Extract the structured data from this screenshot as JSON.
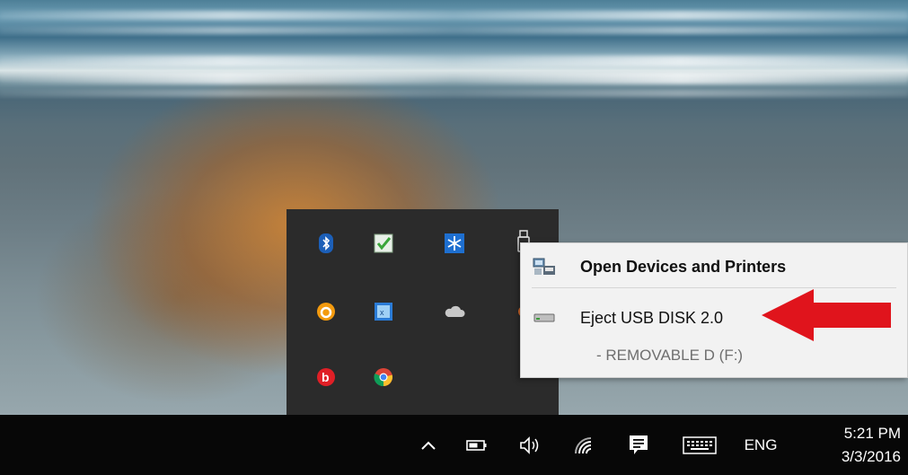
{
  "taskbar": {
    "language": "ENG",
    "time": "5:21 PM",
    "date": "3/3/2016",
    "icons": [
      "chevron-up-icon",
      "battery-icon",
      "speaker-icon",
      "wifi-icon",
      "action-center-icon",
      "keyboard-icon"
    ]
  },
  "overflow_tray": {
    "icons": [
      "bluetooth-icon",
      "checklist-icon",
      "snowflake-icon",
      "usb-drive-icon",
      "orange-circle-app-icon",
      "calculator-app-icon",
      "onedrive-cloud-icon",
      "paint-app-icon",
      "beats-icon",
      "chrome-icon"
    ]
  },
  "context_menu": {
    "items": [
      {
        "label": "Open Devices and Printers",
        "icon": "devices-printers-icon"
      },
      {
        "label": "Eject USB DISK 2.0",
        "icon": "drive-icon"
      }
    ],
    "sub_item": "-   REMOVABLE D (F:)"
  },
  "colors": {
    "taskbar_bg": "#070707",
    "tray_bg": "#2b2b2b",
    "menu_bg": "#f2f2f2",
    "arrow": "#e0141c"
  }
}
